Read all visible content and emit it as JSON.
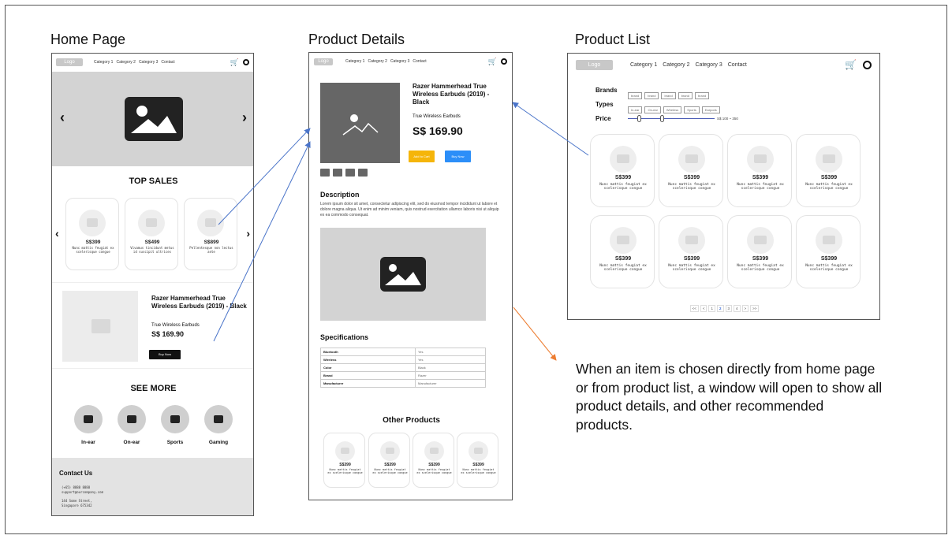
{
  "titles": {
    "home": "Home Page",
    "details": "Product Details",
    "list": "Product List"
  },
  "nav": {
    "logo": "Logo",
    "links": [
      "Category 1",
      "Category 2",
      "Category 3",
      "Contact"
    ]
  },
  "home": {
    "top_sales_heading": "TOP SALES",
    "top_sales": [
      {
        "price": "S$399",
        "desc": "Nunc mattis feugiat ex scelerisque congue"
      },
      {
        "price": "S$499",
        "desc": "Vivamus tincidunt metus id suscipit ultrices"
      },
      {
        "price": "S$899",
        "desc": "Pellentesque non lectus ante"
      }
    ],
    "feature": {
      "name": "Razer Hammerhead True Wireless Earbuds (2019) - Black",
      "subtitle": "True Wireless Earbuds",
      "price": "S$ 169.90",
      "buy_label": "Buy Now"
    },
    "see_more_heading": "SEE MORE",
    "categories": [
      "In-ear",
      "On-ear",
      "Sports",
      "Gaming"
    ],
    "contact": {
      "heading": "Contact Us",
      "phone": "(+65) 8888 8888",
      "email": "support@ourcompany.com",
      "address1": "144 Some Street,",
      "address2": "Singapore 675342"
    }
  },
  "details": {
    "name": "Razer Hammerhead True Wireless Earbuds (2019) - Black",
    "subtitle": "True Wireless Earbuds",
    "price": "S$ 169.90",
    "add_to_cart": "Add to Cart",
    "buy_now": "Buy Now",
    "description_heading": "Description",
    "description_text": "Lorem ipsum dolor sit amet, consectetur adipiscing elit, sed do eiusmod tempor incididunt ut labore et dolore magna aliqua. Ut enim ad minim veniam, quis nostrud exercitation ullamco laboris nisi ut aliquip ex ea commodo consequat.",
    "specs_heading": "Specifications",
    "specs": [
      {
        "k": "Bluetooth",
        "v": "Yes"
      },
      {
        "k": "Wireless",
        "v": "Yes"
      },
      {
        "k": "Color",
        "v": "Black"
      },
      {
        "k": "Brand",
        "v": "Razer"
      },
      {
        "k": "Manufacturer",
        "v": "Manufacturer"
      }
    ],
    "other_heading": "Other Products",
    "other": [
      {
        "price": "S$399",
        "desc": "Nunc mattis feugiat ex scelerisque congue"
      },
      {
        "price": "S$399",
        "desc": "Nunc mattis feugiat ex scelerisque congue"
      },
      {
        "price": "S$399",
        "desc": "Nunc mattis feugiat ex scelerisque congue"
      },
      {
        "price": "S$399",
        "desc": "Nunc mattis feugiat ex scelerisque congue"
      }
    ]
  },
  "list": {
    "brands_label": "Brands",
    "brand_chips": [
      "brand",
      "brand",
      "brand",
      "brand",
      "brand"
    ],
    "types_label": "Types",
    "type_chips": [
      "In-ear",
      "On-ear",
      "Wireless",
      "Sports",
      "Earpods"
    ],
    "price_label": "Price",
    "price_range": "S$ 100 ~ 350",
    "products": [
      {
        "price": "S$399",
        "desc": "Nunc mattis feugiat ex scelerisque congue"
      },
      {
        "price": "S$399",
        "desc": "Nunc mattis feugiat ex scelerisque congue"
      },
      {
        "price": "S$399",
        "desc": "Nunc mattis feugiat ex scelerisque congue"
      },
      {
        "price": "S$399",
        "desc": "Nunc mattis feugiat ex scelerisque congue"
      },
      {
        "price": "S$399",
        "desc": "Nunc mattis feugiat ex scelerisque congue"
      },
      {
        "price": "S$399",
        "desc": "Nunc mattis feugiat ex scelerisque congue"
      },
      {
        "price": "S$399",
        "desc": "Nunc mattis feugiat ex scelerisque congue"
      },
      {
        "price": "S$399",
        "desc": "Nunc mattis feugiat ex scelerisque congue"
      }
    ],
    "pagination": [
      "<<",
      "<",
      "1",
      "2",
      "3",
      "4",
      ">",
      ">>"
    ]
  },
  "caption": "When an item is chosen directly from home page or from product list, a window will open to show all product details, and other recommended products.",
  "colors": {
    "accent_yellow": "#f5b50a",
    "accent_blue": "#2c8ef8",
    "arrow_blue": "#4a74c9",
    "arrow_orange": "#ed7d31"
  }
}
